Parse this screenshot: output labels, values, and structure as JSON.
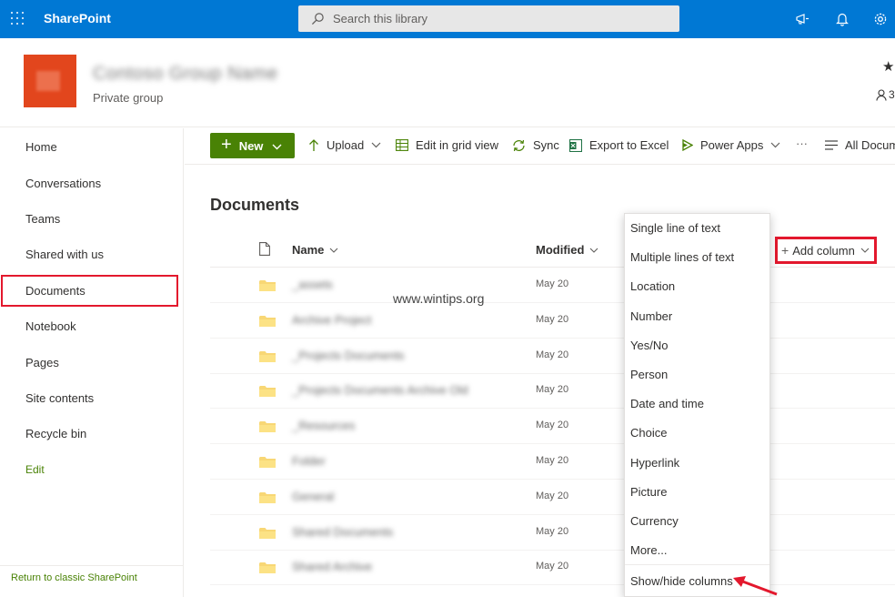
{
  "suite_bar": {
    "app_name": "SharePoint",
    "search_placeholder": "Search this library"
  },
  "site_header": {
    "site_title": "Contoso Group Name",
    "privacy": "Private group",
    "members_label": "3"
  },
  "left_nav": {
    "items": [
      "Home",
      "Conversations",
      "Teams",
      "Shared with us",
      "Documents",
      "Notebook",
      "Pages",
      "Site contents",
      "Recycle bin"
    ],
    "edit_label": "Edit",
    "selected": "Documents",
    "return_link": "Return to classic SharePoint"
  },
  "command_bar": {
    "new_label": "New",
    "upload_label": "Upload",
    "edit_grid_label": "Edit in grid view",
    "sync_label": "Sync",
    "export_label": "Export to Excel",
    "power_apps_label": "Power Apps",
    "more_label": "···",
    "all_docs_label": "All Docum"
  },
  "library": {
    "title": "Documents",
    "columns": {
      "name": "Name",
      "modified": "Modified"
    },
    "add_column_label": "Add column",
    "rows": [
      {
        "name": "_assets",
        "modified": "May 20"
      },
      {
        "name": "Archive Project",
        "modified": "May 20"
      },
      {
        "name": "_Projects Documents",
        "modified": "May 20"
      },
      {
        "name": "_Projects Documents Archive Old",
        "modified": "May 20"
      },
      {
        "name": "_Resources",
        "modified": "May 20"
      },
      {
        "name": "Folder",
        "modified": "May 20"
      },
      {
        "name": "General",
        "modified": "May 20"
      },
      {
        "name": "Shared Documents",
        "modified": "May 20"
      },
      {
        "name": "Shared Archive",
        "modified": "May 20"
      }
    ]
  },
  "add_column_menu": {
    "items": [
      "Single line of text",
      "Multiple lines of text",
      "Location",
      "Number",
      "Yes/No",
      "Person",
      "Date and time",
      "Choice",
      "Hyperlink",
      "Picture",
      "Currency",
      "More..."
    ],
    "footer": "Show/hide columns"
  },
  "watermark": "www.wintips.org",
  "colors": {
    "suite_bar": "#0078d4",
    "accent_green": "#498205",
    "highlight_red": "#e3182d",
    "site_logo": "#e2461d"
  }
}
